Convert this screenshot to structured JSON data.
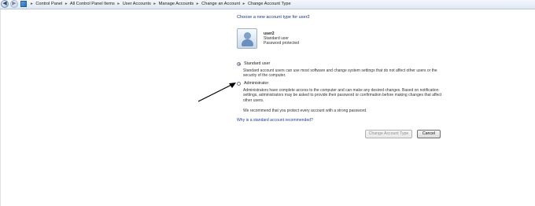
{
  "address_bar": {
    "back_glyph": "◀",
    "forward_glyph": "▶",
    "icon": "control-panel-icon",
    "breadcrumbs": [
      "Control Panel",
      "All Control Panel Items",
      "User Accounts",
      "Manage Accounts",
      "Change an Account",
      "Change Account Type"
    ],
    "separator": "▸"
  },
  "page": {
    "heading": "Choose a new account type for user2",
    "account": {
      "name": "user2",
      "type": "Standard user",
      "status": "Password protected"
    },
    "options": [
      {
        "label": "Standard user",
        "selected": true,
        "description_lines": [
          "Standard account users can use most software and change system settings that do not affect other users or the",
          "security of the computer."
        ]
      },
      {
        "label": "Administrator",
        "selected": false,
        "description_lines": [
          "Administrators have complete access to the computer and can make any desired changes. Based on notification",
          "settings, administrators may be asked to provide their password or confirmation before making changes that affect",
          "other users."
        ]
      }
    ],
    "recommendation": "We recommend that you protect every account with a strong password.",
    "help_link": "Why is a standard account recommended?",
    "buttons": {
      "change": "Change Account Type",
      "cancel": "Cancel"
    }
  },
  "colors": {
    "heading": "#1e3287",
    "link": "#1e3ea0",
    "annotation_arrow": "#000000"
  }
}
